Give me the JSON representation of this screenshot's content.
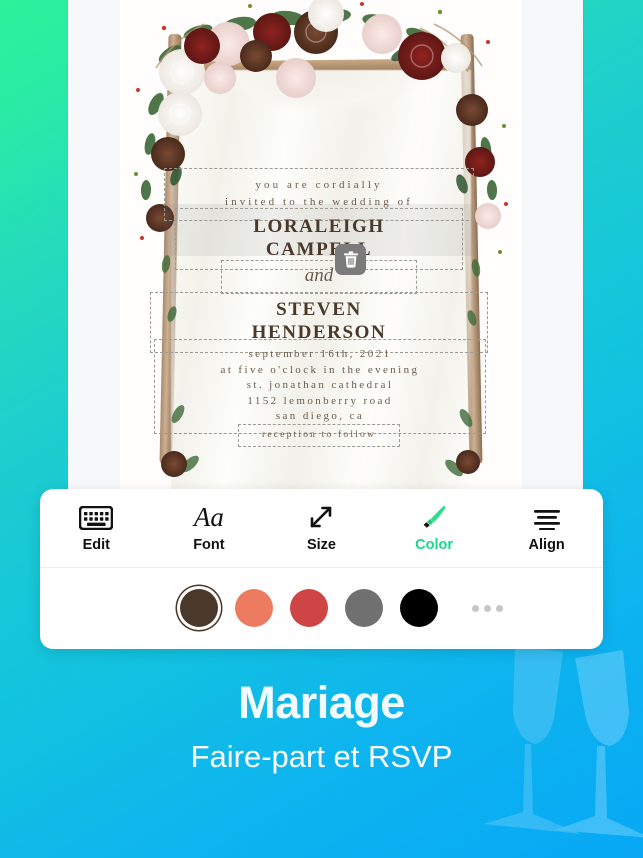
{
  "background": {
    "gradient_from": "#2df29a",
    "gradient_mid": "#18c9d6",
    "gradient_to": "#08a8f5",
    "decoration": "champagne-glasses"
  },
  "card": {
    "intro_line_1": "you are cordially",
    "intro_line_2": "invited to the wedding of",
    "bride_line_1": "LORALEIGH",
    "bride_line_2": "CAMPELL",
    "conjunction": "and",
    "groom_line_1": "STEVEN",
    "groom_line_2": "HENDERSON",
    "details": [
      "september 16th, 2021",
      "at five o'clock in the evening",
      "st. jonathan cathedral",
      "1152 lemonberry road",
      "san diego, ca"
    ],
    "reception": "reception to follow",
    "delete_icon": "trash-icon"
  },
  "toolbar": {
    "items": [
      {
        "label": "Edit",
        "icon": "keyboard-icon",
        "active": false
      },
      {
        "label": "Font",
        "icon": "font-aa-icon",
        "active": false
      },
      {
        "label": "Size",
        "icon": "resize-arrow-icon",
        "active": false
      },
      {
        "label": "Color",
        "icon": "paintbrush-icon",
        "active": true
      },
      {
        "label": "Align",
        "icon": "align-center-icon",
        "active": false
      }
    ],
    "active_color": "#17d98b"
  },
  "colors": {
    "swatches": [
      {
        "name": "dark-brown",
        "hex": "#4a382a",
        "selected": true
      },
      {
        "name": "salmon",
        "hex": "#ec7b5f",
        "selected": false
      },
      {
        "name": "red",
        "hex": "#cf4444",
        "selected": false
      },
      {
        "name": "gray",
        "hex": "#707070",
        "selected": false
      },
      {
        "name": "black",
        "hex": "#000000",
        "selected": false
      }
    ],
    "more_label": "more-colors-icon"
  },
  "promo": {
    "title": "Mariage",
    "subtitle": "Faire-part et RSVP"
  }
}
